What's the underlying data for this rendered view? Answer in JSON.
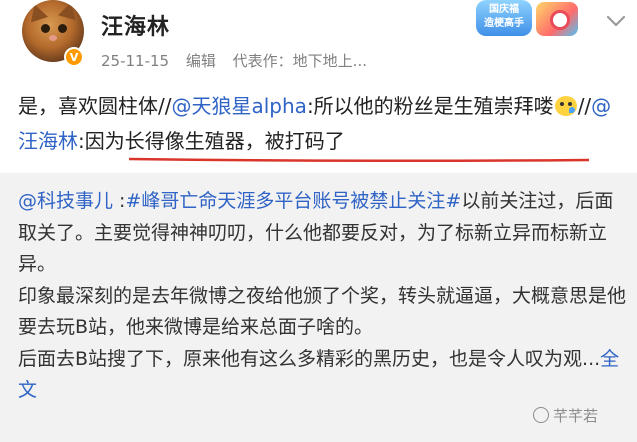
{
  "post": {
    "username": "汪海林",
    "date": "25-11-15",
    "edited": "编辑",
    "representative_work": "代表作：地下地上...",
    "promo_badge_text": "国庆福\n造梗高手",
    "body_parts": {
      "p1": "是，喜欢圆柱体//",
      "mention1": "@天狼星alpha",
      "p2": ":所以他的粉丝是生殖崇拜喽",
      "p3": "//",
      "mention2": "@汪海林",
      "p4": ":因为长得像生殖器，被打码了"
    },
    "underline_color": "#d9352a"
  },
  "repost": {
    "mention": "@科技事儿",
    "space_colon": " :",
    "hashtag": "#峰哥亡命天涯多平台账号被禁止关注#",
    "text_a": "以前关注过，后面取关了。主要觉得神神叨叨，什么他都要反对，为了标新立异而标新立异。",
    "text_b": "印象最深刻的是去年微博之夜给他颁了个奖，转头就逼逼，大概意思是他要去玩B站，他来微博是给来总面子啥的。",
    "text_c": "后面去B站搜了下，原来他有这么多精彩的黑历史，也是令人叹为观...",
    "full_text_link": "全文"
  },
  "watermark": "芊芊若",
  "colors": {
    "link": "#2f63c5",
    "repost_bg": "#f2f2f2",
    "verified": "#ff9a00"
  },
  "icons": {
    "verified": "verified-v-badge",
    "menu": "chevron-down-icon",
    "emoji": "duck-sweat-emoji"
  }
}
